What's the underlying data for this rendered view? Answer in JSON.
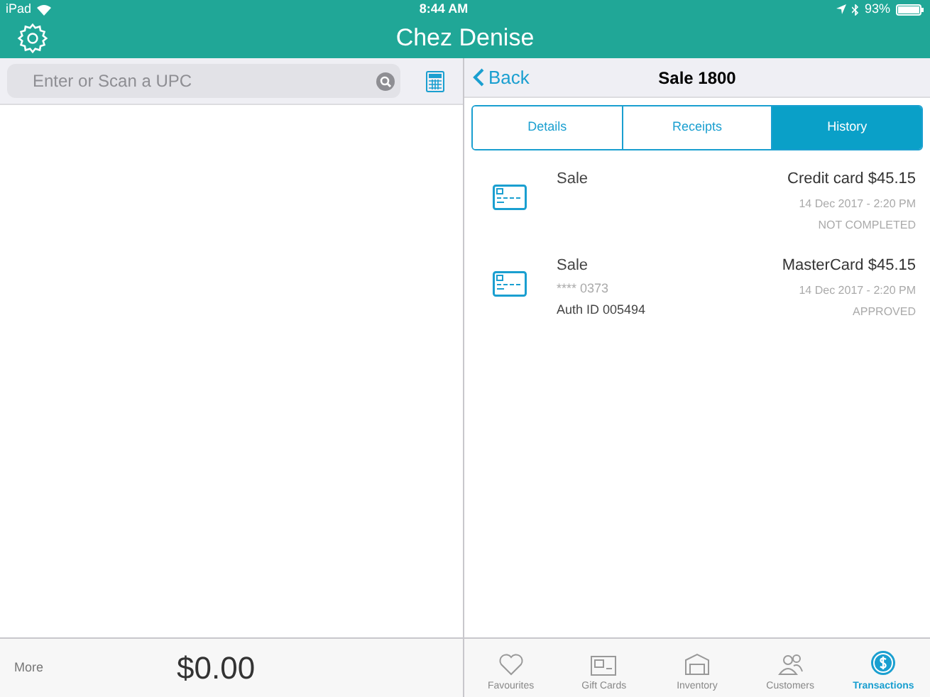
{
  "status_bar": {
    "device": "iPad",
    "time": "8:44 AM",
    "battery": "93%"
  },
  "header": {
    "title": "Chez Denise"
  },
  "search": {
    "placeholder": "Enter or Scan a UPC"
  },
  "cart": {
    "more": "More",
    "total": "$0.00"
  },
  "detail": {
    "back": "Back",
    "title": "Sale 1800"
  },
  "tabs": [
    {
      "label": "Details",
      "selected": false
    },
    {
      "label": "Receipts",
      "selected": false
    },
    {
      "label": "History",
      "selected": true
    }
  ],
  "transactions": [
    {
      "type": "Sale",
      "amount": "Credit card $45.15",
      "date": "14 Dec 2017 - 2:20 PM",
      "status": "NOT COMPLETED"
    },
    {
      "type": "Sale",
      "card": "**** 0373",
      "auth": "Auth ID 005494",
      "amount": "MasterCard $45.15",
      "date": "14 Dec 2017 - 2:20 PM",
      "status": "APPROVED"
    }
  ],
  "tab_bar": [
    {
      "kind": "heart",
      "label": "Favourites",
      "selected": false
    },
    {
      "kind": "giftcard",
      "label": "Gift Cards",
      "selected": false
    },
    {
      "kind": "warehouse",
      "label": "Inventory",
      "selected": false
    },
    {
      "kind": "people",
      "label": "Customers",
      "selected": false
    },
    {
      "kind": "dollar",
      "label": "Transactions",
      "selected": true
    }
  ]
}
